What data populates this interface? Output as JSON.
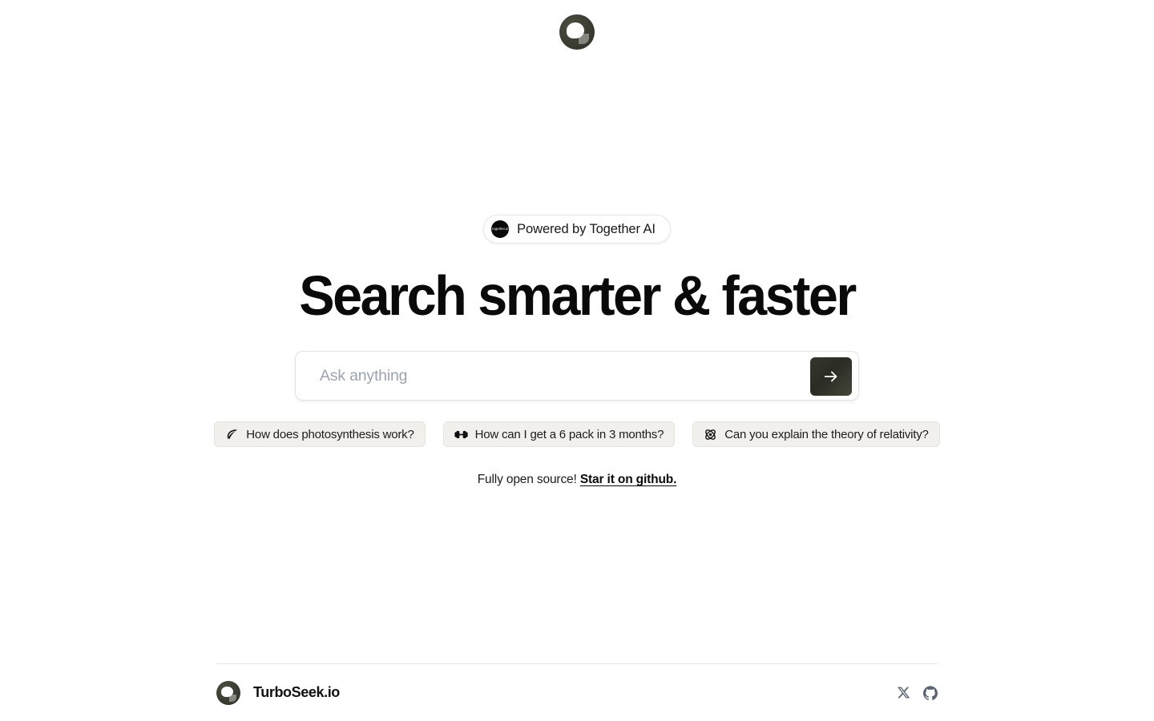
{
  "app": {
    "logo_icon": "turboseek-chat-bubble-logo",
    "brand_name": "TurboSeek.io",
    "accent_dark": "#2e3026",
    "chip_bg": "#f1f0ec",
    "page_bg": "#ffffff"
  },
  "hero": {
    "badge": {
      "icon": "together-ai-logo",
      "badge_text": "together.ai",
      "label": "Powered by Together AI"
    },
    "headline": "Search smarter & faster"
  },
  "search": {
    "placeholder": "Ask anything",
    "value": "",
    "submit_icon": "arrow-right-icon",
    "submit_label": "Submit search"
  },
  "suggestions": [
    {
      "icon": "leaf-icon",
      "label": "How does photosynthesis work?"
    },
    {
      "icon": "dumbbell-icon",
      "label": "How can I get a 6 pack in 3 months?"
    },
    {
      "icon": "atom-icon",
      "label": "Can you explain the theory of relativity?"
    }
  ],
  "open_source": {
    "text": "Fully open source!",
    "link_label": "Star it on github."
  },
  "footer": {
    "brand_name": "TurboSeek.io",
    "socials": [
      {
        "icon": "x-twitter-icon",
        "name": "X"
      },
      {
        "icon": "github-icon",
        "name": "GitHub"
      }
    ]
  }
}
